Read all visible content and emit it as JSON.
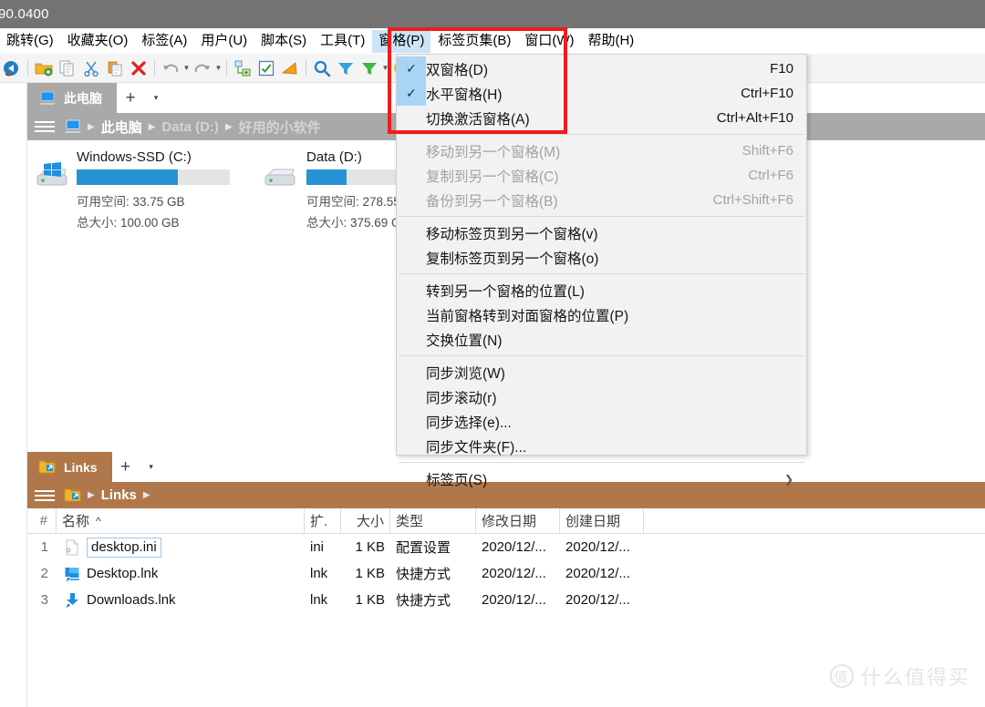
{
  "window": {
    "title": "90.0400"
  },
  "menubar": {
    "items": [
      {
        "label": "跳转(G)",
        "active": false
      },
      {
        "label": "收藏夹(O)",
        "active": false
      },
      {
        "label": "标签(A)",
        "active": false
      },
      {
        "label": "用户(U)",
        "active": false
      },
      {
        "label": "脚本(S)",
        "active": false
      },
      {
        "label": "工具(T)",
        "active": false
      },
      {
        "label": "窗格(P)",
        "active": true
      },
      {
        "label": "标签页集(B)",
        "active": false
      },
      {
        "label": "窗口(W)",
        "active": false
      },
      {
        "label": "帮助(H)",
        "active": false
      }
    ]
  },
  "toolbar": {
    "icons": [
      "back-navigate-icon",
      "new-folder-icon",
      "copy-icon",
      "cut-icon",
      "paste-icon",
      "delete-icon",
      "undo-icon",
      "redo-icon",
      "branch-icon",
      "checkbox-select-icon",
      "filter-marker-icon",
      "search-icon",
      "filter-icon",
      "filter-green-icon",
      "pie-chart-icon"
    ]
  },
  "pane_menu": {
    "title": "窗格(P)",
    "groups": [
      {
        "items": [
          {
            "label": "双窗格(D)",
            "shortcut": "F10",
            "checked": true,
            "disabled": false
          },
          {
            "label": "水平窗格(H)",
            "shortcut": "Ctrl+F10",
            "checked": true,
            "disabled": false
          },
          {
            "label": "切换激活窗格(A)",
            "shortcut": "Ctrl+Alt+F10",
            "checked": false,
            "disabled": false
          }
        ]
      },
      {
        "items": [
          {
            "label": "移动到另一个窗格(M)",
            "shortcut": "Shift+F6",
            "checked": false,
            "disabled": true
          },
          {
            "label": "复制到另一个窗格(C)",
            "shortcut": "Ctrl+F6",
            "checked": false,
            "disabled": true
          },
          {
            "label": "备份到另一个窗格(B)",
            "shortcut": "Ctrl+Shift+F6",
            "checked": false,
            "disabled": true
          }
        ]
      },
      {
        "items": [
          {
            "label": "移动标签页到另一个窗格(v)",
            "shortcut": "",
            "checked": false,
            "disabled": false
          },
          {
            "label": "复制标签页到另一个窗格(o)",
            "shortcut": "",
            "checked": false,
            "disabled": false
          }
        ]
      },
      {
        "items": [
          {
            "label": "转到另一个窗格的位置(L)",
            "shortcut": "",
            "checked": false,
            "disabled": false
          },
          {
            "label": "当前窗格转到对面窗格的位置(P)",
            "shortcut": "",
            "checked": false,
            "disabled": false
          },
          {
            "label": "交换位置(N)",
            "shortcut": "",
            "checked": false,
            "disabled": false
          }
        ]
      },
      {
        "items": [
          {
            "label": "同步浏览(W)",
            "shortcut": "",
            "checked": false,
            "disabled": false
          },
          {
            "label": "同步滚动(r)",
            "shortcut": "",
            "checked": false,
            "disabled": false
          },
          {
            "label": "同步选择(e)...",
            "shortcut": "",
            "checked": false,
            "disabled": false
          },
          {
            "label": "同步文件夹(F)...",
            "shortcut": "",
            "checked": false,
            "disabled": false
          }
        ]
      },
      {
        "items": [
          {
            "label": "标签页(S)",
            "shortcut": "",
            "checked": false,
            "disabled": false,
            "submenu": true
          }
        ]
      }
    ]
  },
  "top_pane": {
    "tab": {
      "label": "此电脑",
      "icon": "computer-icon"
    },
    "new_tab_label": "+",
    "tab_dropdown_label": "▾",
    "breadcrumb": [
      {
        "label": "此电脑",
        "dim": false
      },
      {
        "label": "Data (D:)",
        "dim": true
      },
      {
        "label": "好用的小软件",
        "dim": true
      }
    ],
    "drives": [
      {
        "name": "Windows-SSD (C:)",
        "icon": "windows-drive-icon",
        "used_percent": 66,
        "free_label": "可用空间",
        "free_value": "33.75 GB",
        "total_label": "总大小",
        "total_value": "100.00 GB"
      },
      {
        "name": "Data (D:)",
        "icon": "hdd-drive-icon",
        "used_percent": 26,
        "free_label": "可用空间",
        "free_value": "278.55",
        "total_label": "总大小",
        "total_value": "375.69 G"
      }
    ]
  },
  "bottom_pane": {
    "tab": {
      "label": "Links",
      "icon": "folder-shortcut-icon"
    },
    "new_tab_label": "+",
    "tab_dropdown_label": "▾",
    "breadcrumb": [
      {
        "label": "Links",
        "dim": false
      }
    ],
    "columns": [
      "#",
      "名称",
      "扩.",
      "大小",
      "类型",
      "修改日期",
      "创建日期"
    ],
    "sort_indicator": "^",
    "rows": [
      {
        "num": "1",
        "name": "desktop.ini",
        "icon": "ini-file-icon",
        "selected": true,
        "ext": "ini",
        "size": "1 KB",
        "type": "配置设置",
        "modified": "2020/12/...",
        "created": "2020/12/..."
      },
      {
        "num": "2",
        "name": "Desktop.lnk",
        "icon": "desktop-shortcut-icon",
        "selected": false,
        "ext": "lnk",
        "size": "1 KB",
        "type": "快捷方式",
        "modified": "2020/12/...",
        "created": "2020/12/..."
      },
      {
        "num": "3",
        "name": "Downloads.lnk",
        "icon": "downloads-shortcut-icon",
        "selected": false,
        "ext": "lnk",
        "size": "1 KB",
        "type": "快捷方式",
        "modified": "2020/12/...",
        "created": "2020/12/..."
      }
    ]
  },
  "annotation": {
    "name": "red-highlight-box",
    "color": "#ee1c1c"
  },
  "watermark": {
    "mark": "值",
    "text": "什么值得买"
  },
  "colors": {
    "titlebar": "#737373",
    "accent_blue": "#2792d4",
    "tab_gray": "#a9a9a9",
    "tab_brown": "#b0784a",
    "menu_highlight": "#cce4f7",
    "check_highlight": "#a8d4f5"
  }
}
